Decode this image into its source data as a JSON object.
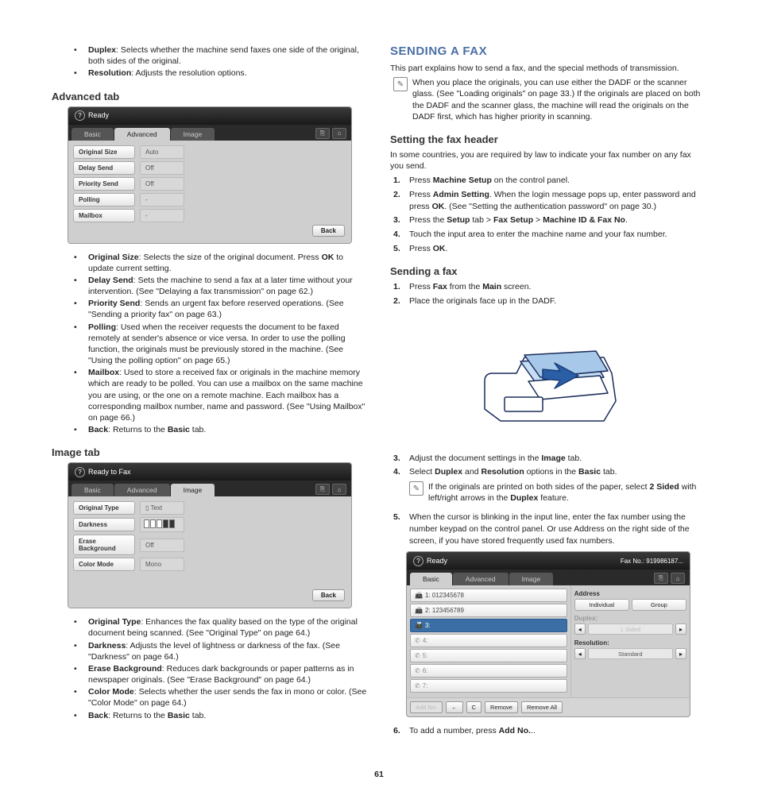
{
  "page_number": "61",
  "left": {
    "intro_bullets": [
      {
        "term": "Duplex",
        "desc": ": Selects whether the machine send faxes one side of the original, both sides of the original."
      },
      {
        "term": "Resolution",
        "desc": ": Adjusts the resolution options."
      }
    ],
    "advanced_heading": "Advanced tab",
    "advanced_ss": {
      "status": "Ready",
      "tabs": [
        "Basic",
        "Advanced",
        "Image"
      ],
      "rows": [
        {
          "label": "Original Size",
          "value": "Auto"
        },
        {
          "label": "Delay Send",
          "value": "Off"
        },
        {
          "label": "Priority Send",
          "value": "Off"
        },
        {
          "label": "Polling",
          "value": "-"
        },
        {
          "label": "Mailbox",
          "value": "-"
        }
      ],
      "back": "Back"
    },
    "advanced_bullets": [
      {
        "term": "Original Size",
        "desc": ": Selects the size of the original document. Press ",
        "bold2": "OK",
        "desc2": " to update current setting."
      },
      {
        "term": "Delay Send",
        "desc": ": Sets the machine to send a fax at a later time without your intervention. (See \"Delaying a fax transmission\" on page 62.)"
      },
      {
        "term": "Priority Send",
        "desc": ": Sends an urgent fax before reserved operations. (See \"Sending a priority fax\" on page 63.)"
      },
      {
        "term": "Polling",
        "desc": ": Used when the receiver requests the document to be faxed remotely at sender's absence or vice versa. In order to use the polling function, the originals must be previously stored in the machine. (See \"Using the polling option\" on page 65.)"
      },
      {
        "term": "Mailbox",
        "desc": ": Used to store a received fax or originals in the machine memory which are ready to be polled. You can use a mailbox on the same machine you are using, or the one on a remote machine. Each mailbox has a corresponding mailbox number, name and password. (See \"Using Mailbox\" on page 66.)"
      },
      {
        "term": "Back",
        "desc": ": Returns to the ",
        "bold2": "Basic",
        "desc2": " tab."
      }
    ],
    "image_heading": "Image tab",
    "image_ss": {
      "status": "Ready to Fax",
      "tabs": [
        "Basic",
        "Advanced",
        "Image"
      ],
      "rows": [
        {
          "label": "Original Type",
          "value": "Text",
          "icon": true
        },
        {
          "label": "Darkness",
          "value": "bars"
        },
        {
          "label": "Erase Background",
          "value": "Off"
        },
        {
          "label": "Color Mode",
          "value": "Mono"
        }
      ],
      "back": "Back"
    },
    "image_bullets": [
      {
        "term": "Original Type",
        "desc": ": Enhances the fax quality based on the type of the original document being scanned. (See \"Original Type\" on page 64.)"
      },
      {
        "term": "Darkness",
        "desc": ": Adjusts the level of lightness or darkness of the fax. (See \"Darkness\" on page 64.)"
      },
      {
        "term": "Erase Background",
        "desc": ": Reduces dark backgrounds or paper patterns as in newspaper originals. (See \"Erase Background\" on page 64.)"
      },
      {
        "term": "Color Mode",
        "desc": ": Selects whether the user sends the fax in mono or color. (See \"Color Mode\" on page 64.)"
      },
      {
        "term": "Back",
        "desc": ": Returns to the ",
        "bold2": "Basic",
        "desc2": " tab."
      }
    ]
  },
  "right": {
    "title": "SENDING A FAX",
    "intro": "This part explains how to send a fax, and the special methods of transmission.",
    "note1": "When you place the originals, you can use either the DADF or the scanner glass. (See \"Loading originals\" on page 33.) If the originals are placed on both the DADF and the scanner glass, the machine will read the originals on the DADF first, which has higher priority in scanning.",
    "settingHeader_h": "Setting the fax header",
    "settingHeader_p": "In some countries, you are required by law to indicate your fax number on any fax you send.",
    "settingHeader_steps": [
      {
        "n": "1.",
        "parts": [
          "Press ",
          "Machine Setup",
          " on the control panel."
        ]
      },
      {
        "n": "2.",
        "parts": [
          "Press ",
          "Admin Setting",
          ". When the login message pops up, enter password and press ",
          "OK",
          ". (See \"Setting the authentication password\" on page 30.)"
        ]
      },
      {
        "n": "3.",
        "parts": [
          "Press the ",
          "Setup",
          " tab > ",
          "Fax Setup",
          " > ",
          "Machine ID & Fax No",
          "."
        ]
      },
      {
        "n": "4.",
        "parts": [
          "Touch the input area to enter the machine name and your fax number."
        ]
      },
      {
        "n": "5.",
        "parts": [
          "Press ",
          "OK",
          "."
        ]
      }
    ],
    "sendingFax_h": "Sending a fax",
    "sendingFax_steps": [
      {
        "n": "1.",
        "parts": [
          "Press ",
          "Fax",
          " from the ",
          "Main",
          " screen."
        ]
      },
      {
        "n": "2.",
        "parts": [
          "Place the originals face up in the DADF."
        ]
      }
    ],
    "steps_after": [
      {
        "n": "3.",
        "parts": [
          "Adjust the document settings in the ",
          "Image",
          " tab."
        ]
      },
      {
        "n": "4.",
        "parts": [
          "Select ",
          "Duplex",
          " and ",
          "Resolution",
          " options in the ",
          "Basic",
          " tab."
        ]
      }
    ],
    "note2": "If the originals are printed on both sides of the paper, select ",
    "note2_b1": "2 Sided",
    "note2_mid": " with left/right arrows in the ",
    "note2_b2": "Duplex",
    "note2_end": " feature.",
    "step5": {
      "n": "5.",
      "parts": [
        "When the cursor is blinking in the input line, enter the fax number using the number keypad on the control panel. Or use Address on the right side of the screen, if you have stored frequently used fax numbers."
      ]
    },
    "fax_ss": {
      "status": "Ready",
      "faxno_label": "Fax No.:",
      "faxno": "919986187...",
      "tabs": [
        "Basic",
        "Advanced",
        "Image"
      ],
      "numbers": [
        "1: 012345678",
        "2: 123456789",
        "3:",
        "4:",
        "5:",
        "6:",
        "7:"
      ],
      "address_label": "Address",
      "address_btns": [
        "Individual",
        "Group"
      ],
      "duplex_label": "Duplex:",
      "duplex_val": "1 Sided",
      "res_label": "Resolution:",
      "res_val": "Standard",
      "bottom": [
        "Add No.",
        "←",
        "C",
        "Remove",
        "Remove All"
      ]
    },
    "step6": {
      "n": "6.",
      "parts": [
        "To add a number, press ",
        "Add No.",
        ".."
      ]
    }
  }
}
